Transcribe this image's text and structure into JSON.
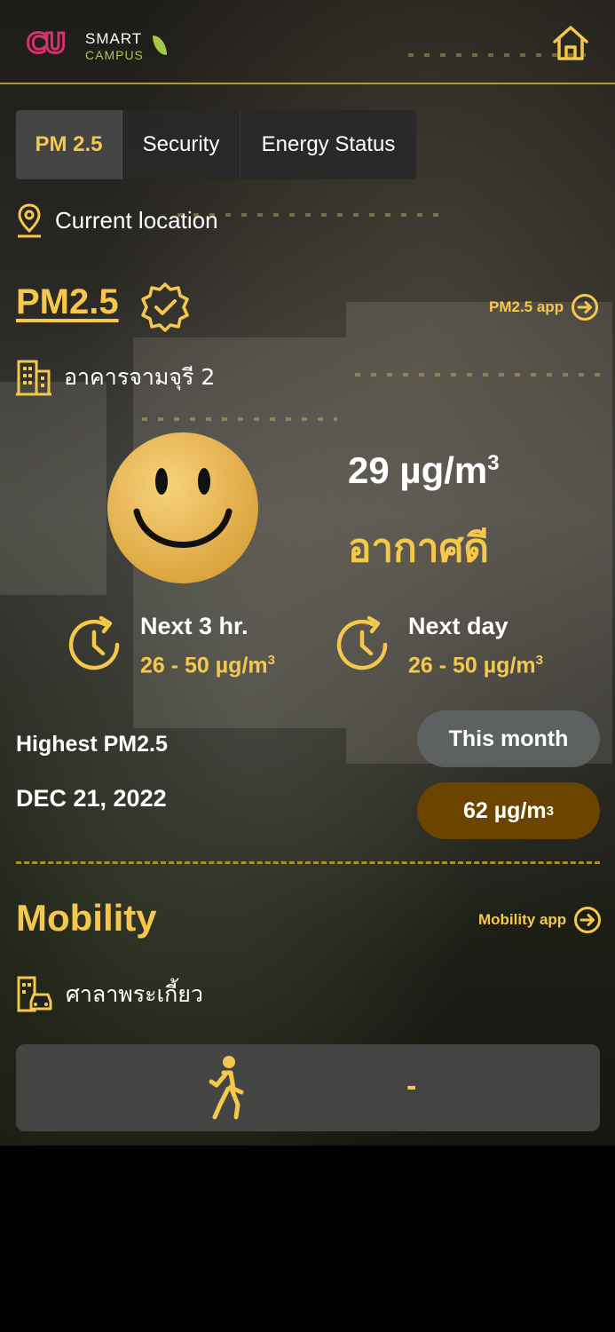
{
  "header": {
    "logo_cu": "CU",
    "logo_smart": "SMART",
    "logo_campus": "CAMPUS",
    "home_icon": "home-icon"
  },
  "tabs": [
    {
      "label": "PM 2.5",
      "active": true
    },
    {
      "label": "Security",
      "active": false
    },
    {
      "label": "Energy Status",
      "active": false
    }
  ],
  "location": {
    "icon": "location-pin-icon",
    "label": "Current location"
  },
  "pm25": {
    "title": "PM2.5",
    "app_link": "PM2.5 app",
    "building": "อาคารจามจุรี 2",
    "value": "29 µg/m",
    "unit_exp": "3",
    "status": "อากาศดี",
    "forecast": [
      {
        "label": "Next 3 hr.",
        "range": "26 - 50 µg/m",
        "exp": "3"
      },
      {
        "label": "Next day",
        "range": "26 - 50 µg/m",
        "exp": "3"
      }
    ],
    "highest_label": "Highest PM2.5",
    "highest_date": "DEC 21, 2022",
    "period_label": "This month",
    "highest_value": "62 µg/m",
    "highest_exp": "3"
  },
  "mobility": {
    "title": "Mobility",
    "app_link": "Mobility app",
    "location": "ศาลาพระเกี้ยว",
    "walk_value": "-"
  },
  "colors": {
    "accent": "#f5c84c",
    "pill_dark": "#6b4500",
    "divider": "#a98e2a"
  }
}
